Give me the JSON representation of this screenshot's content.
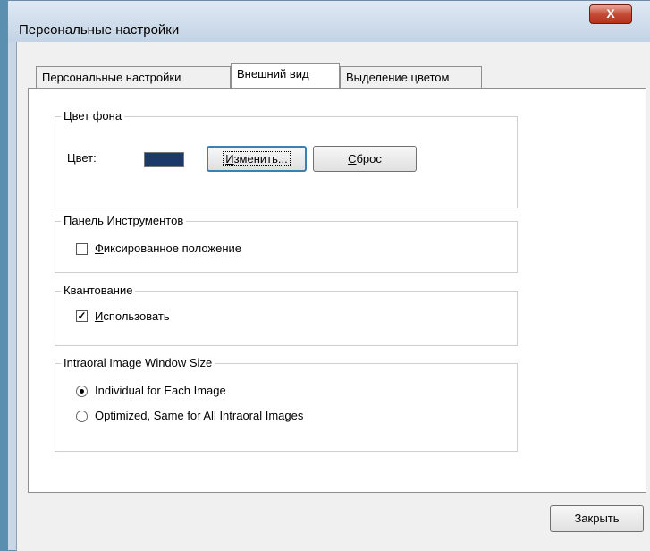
{
  "window": {
    "title": "Персональные настройки",
    "close_glyph": "X"
  },
  "tabs": [
    {
      "label": "Персональные настройки",
      "active": false
    },
    {
      "label": "Внешний вид",
      "active": true
    },
    {
      "label": "Выделение цветом",
      "active": false
    }
  ],
  "background_group": {
    "legend": "Цвет фона",
    "color_label": "Цвет:",
    "color_value": "#1b3a6b",
    "change_prefix": "",
    "change_mnemonic": "И",
    "change_suffix": "зменить...",
    "reset_mnemonic": "С",
    "reset_suffix": "брос"
  },
  "toolbar_group": {
    "legend": "Панель Инструментов",
    "fixed_mnemonic": "Ф",
    "fixed_suffix": "иксированное положение",
    "fixed_checked": false
  },
  "quantization_group": {
    "legend": "Квантование",
    "use_mnemonic": "И",
    "use_suffix": "спользовать",
    "use_checked": true,
    "check_glyph": "✓"
  },
  "intraoral_group": {
    "legend": "Intraoral Image Window Size",
    "options": [
      {
        "label": "Individual for Each Image",
        "selected": true
      },
      {
        "label": "Optimized, Same for All Intraoral Images",
        "selected": false
      }
    ]
  },
  "footer": {
    "close_label": "Закрыть"
  }
}
